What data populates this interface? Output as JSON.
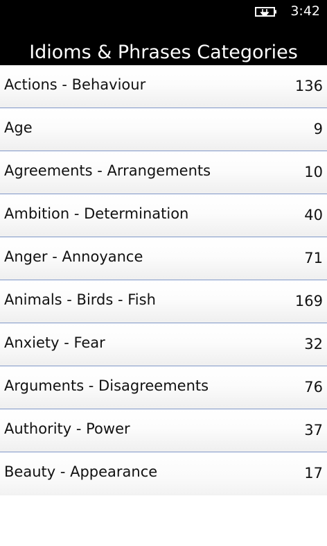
{
  "status_bar": {
    "time": "3:42",
    "battery_icon": "battery-charging-icon"
  },
  "header": {
    "title": "Idioms & Phrases Categories"
  },
  "categories": [
    {
      "label": "Actions - Behaviour",
      "count": "136"
    },
    {
      "label": "Age",
      "count": "9"
    },
    {
      "label": "Agreements - Arrangements",
      "count": "10"
    },
    {
      "label": "Ambition - Determination",
      "count": "40"
    },
    {
      "label": "Anger - Annoyance",
      "count": "71"
    },
    {
      "label": "Animals - Birds - Fish",
      "count": "169"
    },
    {
      "label": "Anxiety - Fear",
      "count": "32"
    },
    {
      "label": "Arguments - Disagreements",
      "count": "76"
    },
    {
      "label": "Authority - Power",
      "count": "37"
    },
    {
      "label": "Beauty - Appearance",
      "count": "17"
    }
  ],
  "colors": {
    "header_background": "#000000",
    "divider": "#7f97c8",
    "text": "#111111"
  }
}
